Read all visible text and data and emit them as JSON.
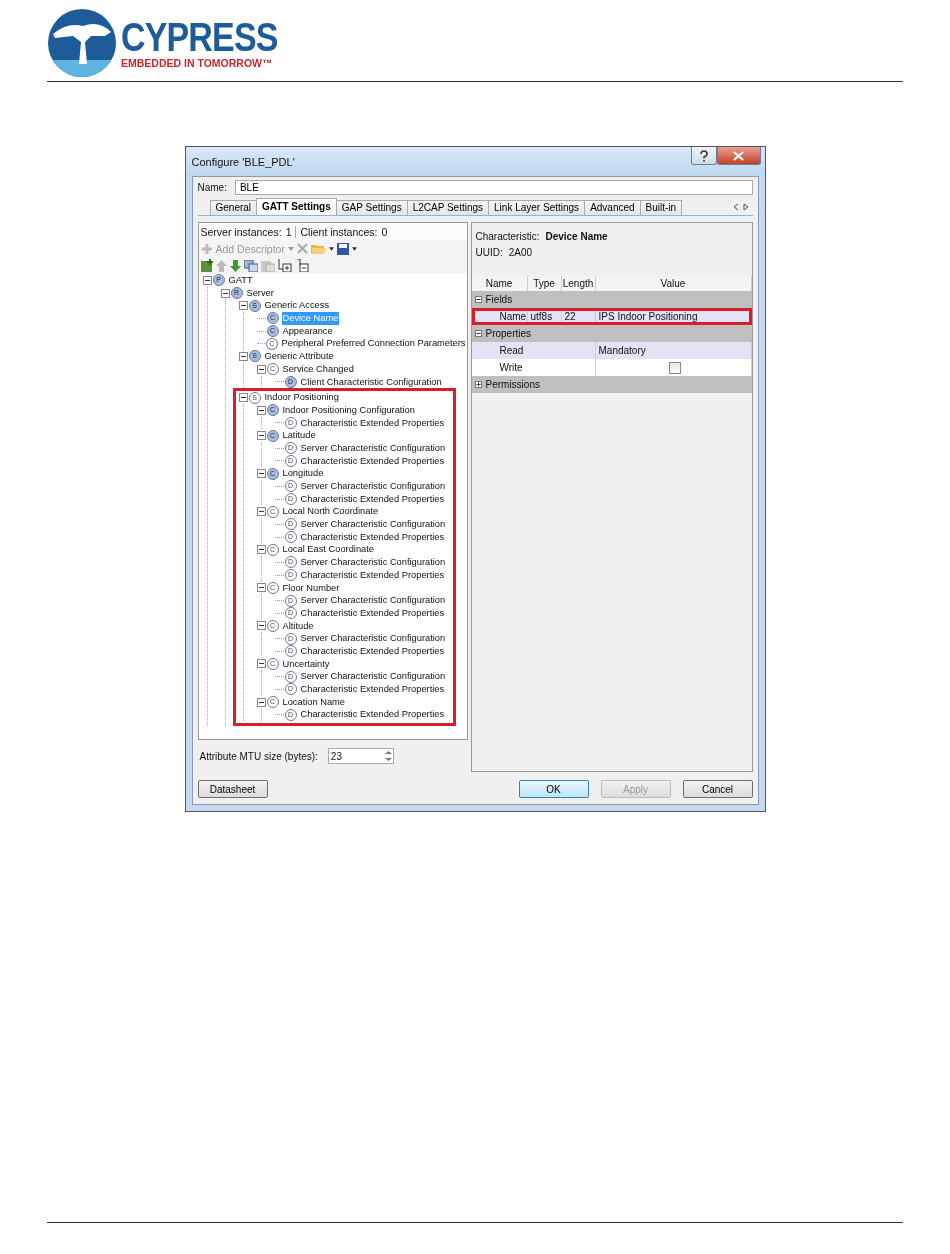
{
  "header": {
    "brand": "CYPRESS",
    "tagline": "EMBEDDED IN TOMORROW™"
  },
  "window": {
    "title": "Configure 'BLE_PDL'"
  },
  "name_field": {
    "label": "Name:",
    "value": "BLE"
  },
  "tabs": [
    {
      "label": "General",
      "selected": false
    },
    {
      "label": "GATT Settings",
      "selected": true
    },
    {
      "label": "GAP Settings",
      "selected": false
    },
    {
      "label": "L2CAP Settings",
      "selected": false
    },
    {
      "label": "Link Layer Settings",
      "selected": false
    },
    {
      "label": "Advanced",
      "selected": false
    },
    {
      "label": "Built-in",
      "selected": false
    }
  ],
  "instances": {
    "server_label": "Server instances:",
    "server_value": "1",
    "client_label": "Client instances:",
    "client_value": "0"
  },
  "toolbar": {
    "add_descriptor": "Add Descriptor",
    "disabled": true
  },
  "tree": [
    {
      "label": "GATT",
      "badge": "P",
      "filled": true,
      "expanded": true,
      "selected": false,
      "highlighted": false,
      "children": [
        {
          "label": "Server",
          "badge": "R",
          "filled": true,
          "expanded": true,
          "selected": false,
          "highlighted": false,
          "children": [
            {
              "label": "Generic Access",
              "badge": "S",
              "filled": true,
              "expanded": true,
              "selected": false,
              "highlighted": false,
              "children": [
                {
                  "label": "Device Name",
                  "badge": "C",
                  "filled": true,
                  "selected": true,
                  "highlighted": false
                },
                {
                  "label": "Appearance",
                  "badge": "C",
                  "filled": true,
                  "selected": false,
                  "highlighted": false
                },
                {
                  "label": "Peripheral Preferred Connection Parameters",
                  "badge": "C",
                  "filled": false,
                  "selected": false,
                  "highlighted": false
                }
              ]
            },
            {
              "label": "Generic Attribute",
              "badge": "S",
              "filled": true,
              "expanded": true,
              "selected": false,
              "highlighted": false,
              "children": [
                {
                  "label": "Service Changed",
                  "badge": "C",
                  "filled": false,
                  "expanded": true,
                  "selected": false,
                  "highlighted": false,
                  "children": [
                    {
                      "label": "Client Characteristic Configuration",
                      "badge": "D",
                      "filled": true,
                      "selected": false,
                      "highlighted": false
                    }
                  ]
                }
              ]
            },
            {
              "label": "Indoor Positioning",
              "badge": "S",
              "filled": false,
              "expanded": true,
              "selected": false,
              "highlighted": true,
              "children": [
                {
                  "label": "Indoor Positioning Configuration",
                  "badge": "C",
                  "filled": true,
                  "expanded": true,
                  "selected": false,
                  "highlighted": false,
                  "children": [
                    {
                      "label": "Characteristic Extended Properties",
                      "badge": "D",
                      "filled": false,
                      "selected": false,
                      "highlighted": false
                    }
                  ]
                },
                {
                  "label": "Latitude",
                  "badge": "C",
                  "filled": true,
                  "expanded": true,
                  "selected": false,
                  "highlighted": false,
                  "children": [
                    {
                      "label": "Server Characteristic Configuration",
                      "badge": "D",
                      "filled": false,
                      "selected": false,
                      "highlighted": false
                    },
                    {
                      "label": "Characteristic Extended Properties",
                      "badge": "D",
                      "filled": false,
                      "selected": false,
                      "highlighted": false
                    }
                  ]
                },
                {
                  "label": "Longitude",
                  "badge": "C",
                  "filled": true,
                  "expanded": true,
                  "selected": false,
                  "highlighted": false,
                  "children": [
                    {
                      "label": "Server Characteristic Configuration",
                      "badge": "D",
                      "filled": false,
                      "selected": false,
                      "highlighted": false
                    },
                    {
                      "label": "Characteristic Extended Properties",
                      "badge": "D",
                      "filled": false,
                      "selected": false,
                      "highlighted": false
                    }
                  ]
                },
                {
                  "label": "Local North Coordinate",
                  "badge": "C",
                  "filled": false,
                  "expanded": true,
                  "selected": false,
                  "highlighted": false,
                  "children": [
                    {
                      "label": "Server Characteristic Configuration",
                      "badge": "D",
                      "filled": false,
                      "selected": false,
                      "highlighted": false
                    },
                    {
                      "label": "Characteristic Extended Properties",
                      "badge": "D",
                      "filled": false,
                      "selected": false,
                      "highlighted": false
                    }
                  ]
                },
                {
                  "label": "Local East Coordinate",
                  "badge": "C",
                  "filled": false,
                  "expanded": true,
                  "selected": false,
                  "highlighted": false,
                  "children": [
                    {
                      "label": "Server Characteristic Configuration",
                      "badge": "D",
                      "filled": false,
                      "selected": false,
                      "highlighted": false
                    },
                    {
                      "label": "Characteristic Extended Properties",
                      "badge": "D",
                      "filled": false,
                      "selected": false,
                      "highlighted": false
                    }
                  ]
                },
                {
                  "label": "Floor Number",
                  "badge": "C",
                  "filled": false,
                  "expanded": true,
                  "selected": false,
                  "highlighted": false,
                  "children": [
                    {
                      "label": "Server Characteristic Configuration",
                      "badge": "D",
                      "filled": false,
                      "selected": false,
                      "highlighted": false
                    },
                    {
                      "label": "Characteristic Extended Properties",
                      "badge": "D",
                      "filled": false,
                      "selected": false,
                      "highlighted": false
                    }
                  ]
                },
                {
                  "label": "Altitude",
                  "badge": "C",
                  "filled": false,
                  "expanded": true,
                  "selected": false,
                  "highlighted": false,
                  "children": [
                    {
                      "label": "Server Characteristic Configuration",
                      "badge": "D",
                      "filled": false,
                      "selected": false,
                      "highlighted": false
                    },
                    {
                      "label": "Characteristic Extended Properties",
                      "badge": "D",
                      "filled": false,
                      "selected": false,
                      "highlighted": false
                    }
                  ]
                },
                {
                  "label": "Uncertainty",
                  "badge": "C",
                  "filled": false,
                  "expanded": true,
                  "selected": false,
                  "highlighted": false,
                  "children": [
                    {
                      "label": "Server Characteristic Configuration",
                      "badge": "D",
                      "filled": false,
                      "selected": false,
                      "highlighted": false
                    },
                    {
                      "label": "Characteristic Extended Properties",
                      "badge": "D",
                      "filled": false,
                      "selected": false,
                      "highlighted": false
                    }
                  ]
                },
                {
                  "label": "Location Name",
                  "badge": "C",
                  "filled": false,
                  "expanded": true,
                  "selected": false,
                  "highlighted": false,
                  "children": [
                    {
                      "label": "Characteristic Extended Properties",
                      "badge": "D",
                      "filled": false,
                      "selected": false,
                      "highlighted": false
                    }
                  ]
                }
              ]
            }
          ]
        }
      ]
    }
  ],
  "mtu": {
    "label": "Attribute MTU size (bytes):",
    "value": "23"
  },
  "details": {
    "characteristic_label": "Characteristic:",
    "characteristic_value": "Device Name",
    "uuid_label": "UUID:",
    "uuid_value": "2A00"
  },
  "grid": {
    "columns": [
      "Name",
      "Type",
      "Length",
      "Value"
    ],
    "sections": [
      {
        "label": "Fields",
        "expanded": true,
        "rows": [
          {
            "kind": "text",
            "cells": [
              "Name",
              "utf8s",
              "22",
              "IPS Indoor Positioning"
            ],
            "highlighted": true
          }
        ]
      },
      {
        "label": "Properties",
        "expanded": true,
        "rows": [
          {
            "kind": "text",
            "cells": [
              "Read",
              "Mandatory"
            ],
            "highlighted": false
          },
          {
            "kind": "checkbox",
            "cells": [
              "Write"
            ],
            "checked": false,
            "highlighted": false
          }
        ]
      },
      {
        "label": "Permissions",
        "expanded": false
      }
    ]
  },
  "buttons": [
    {
      "label": "Datasheet",
      "kind": "secondary",
      "disabled": false
    },
    {
      "label": "OK",
      "kind": "default",
      "disabled": false
    },
    {
      "label": "Apply",
      "kind": "plain",
      "disabled": true
    },
    {
      "label": "Cancel",
      "kind": "plain",
      "disabled": false
    }
  ]
}
